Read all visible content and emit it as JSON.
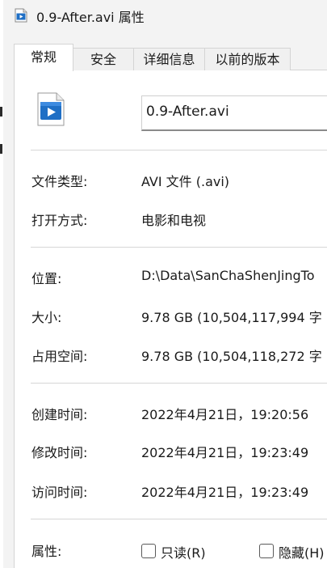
{
  "window": {
    "title": "0.9-After.avi 属性",
    "icon": "video-file-icon"
  },
  "tabs": [
    {
      "label": "常规",
      "active": true
    },
    {
      "label": "安全",
      "active": false
    },
    {
      "label": "详细信息",
      "active": false
    },
    {
      "label": "以前的版本",
      "active": false
    }
  ],
  "general": {
    "file_icon": "video-file-icon",
    "file_name": "0.9-After.avi",
    "file_type_label": "文件类型:",
    "file_type_value": "AVI 文件 (.avi)",
    "opens_with_label": "打开方式:",
    "opens_with_value": "电影和电视",
    "location_label": "位置:",
    "location_value": "D:\\Data\\SanChaShenJingTo",
    "size_label": "大小:",
    "size_value": "9.78 GB (10,504,117,994 字",
    "size_on_disk_label": "占用空间:",
    "size_on_disk_value": "9.78 GB (10,504,118,272 字",
    "created_label": "创建时间:",
    "created_value": "2022年4月21日，19:20:56",
    "modified_label": "修改时间:",
    "modified_value": "2022年4月21日，19:23:49",
    "accessed_label": "访问时间:",
    "accessed_value": "2022年4月21日，19:23:49",
    "attributes_label": "属性:",
    "readonly_label": "只读(R)",
    "readonly_checked": false,
    "hidden_label": "隐藏(H)",
    "hidden_checked": false
  },
  "colors": {
    "accent": "#1f6fc5",
    "window_bg": "#f3f3f3",
    "panel_bg": "#ffffff"
  }
}
